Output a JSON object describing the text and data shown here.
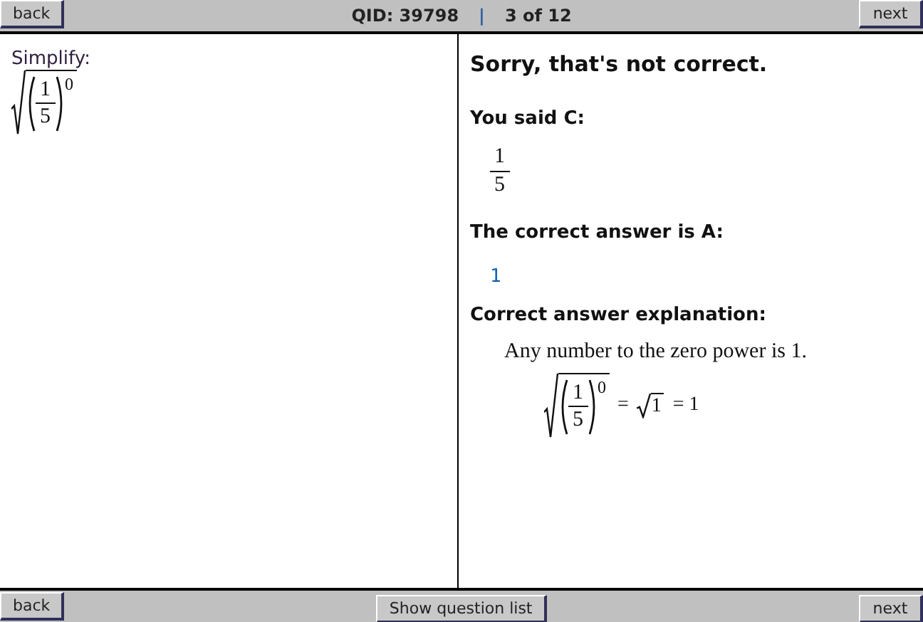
{
  "top_bar": {
    "back": "back",
    "qid": "QID: 39798",
    "separator": "|",
    "position": "3 of 12",
    "next": "next"
  },
  "question": {
    "prompt": "Simplify:",
    "expression": {
      "numerator": "1",
      "denominator": "5",
      "exponent": "0"
    }
  },
  "feedback": {
    "heading": "Sorry, that's not correct.",
    "you_said": {
      "label": "You said C:",
      "answer": {
        "numerator": "1",
        "denominator": "5"
      }
    },
    "correct": {
      "label": "The correct answer is A:",
      "answer": "1"
    },
    "explanation": {
      "label": "Correct answer explanation:",
      "sentence": "Any number to the zero power is 1.",
      "expression": {
        "numerator": "1",
        "denominator": "5",
        "exponent": "0"
      },
      "equals": "=",
      "radicand": "1",
      "result": "= 1"
    }
  },
  "bottom_bar": {
    "back": "back",
    "list": "Show question list",
    "next": "next"
  }
}
